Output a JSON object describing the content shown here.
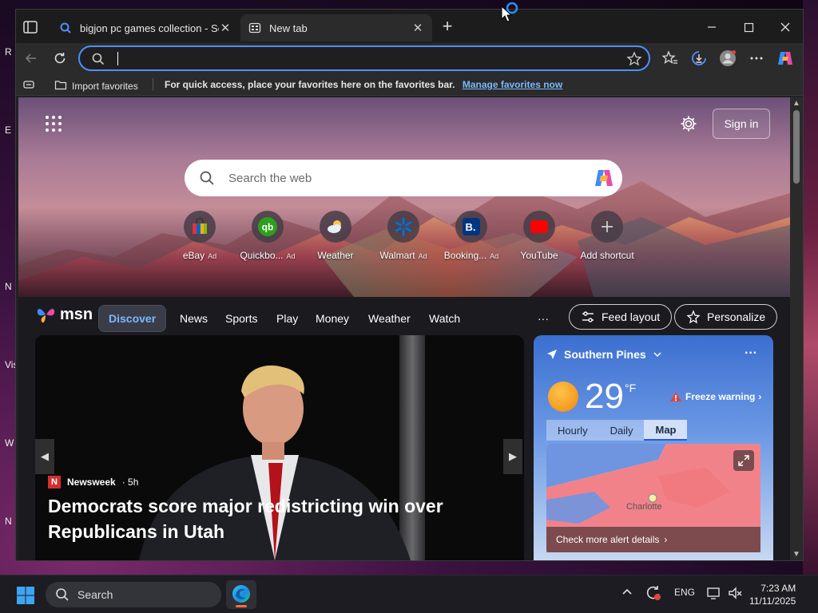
{
  "desktop": {
    "left_fragments": [
      "R",
      "E",
      "N",
      "Vis",
      "W",
      "N"
    ]
  },
  "tabs": [
    {
      "title": "bigjon pc games collection - Sear",
      "active": false,
      "favicon": "search-icon"
    },
    {
      "title": "New tab",
      "active": true,
      "favicon": "newtab-icon"
    }
  ],
  "address_bar": {
    "value": "",
    "placeholder": ""
  },
  "favorites_bar": {
    "import_label": "Import favorites",
    "hint": "For quick access, place your favorites here on the favorites bar.",
    "manage_link": "Manage favorites now"
  },
  "newtab": {
    "signin_label": "Sign in",
    "search_placeholder": "Search the web",
    "shortcuts": [
      {
        "label": "eBay",
        "ad": "Ad",
        "icon": "ebay-icon"
      },
      {
        "label": "Quickbo...",
        "ad": "Ad",
        "icon": "quickbooks-icon"
      },
      {
        "label": "Weather",
        "ad": "",
        "icon": "weather-icon"
      },
      {
        "label": "Walmart",
        "ad": "Ad",
        "icon": "walmart-icon"
      },
      {
        "label": "Booking...",
        "ad": "Ad",
        "icon": "booking-icon"
      },
      {
        "label": "YouTube",
        "ad": "",
        "icon": "youtube-icon"
      },
      {
        "label": "Add shortcut",
        "ad": "",
        "icon": "plus-icon"
      }
    ]
  },
  "msn": {
    "logo_text": "msn",
    "nav": [
      "Discover",
      "News",
      "Sports",
      "Play",
      "Money",
      "Weather",
      "Watch"
    ],
    "more": "···",
    "feed_layout_label": "Feed layout",
    "personalize_label": "Personalize"
  },
  "feed": {
    "source": "Newsweek",
    "age": "· 5h",
    "headline": "Democrats score major redistricting win over Republicans in Utah"
  },
  "weather": {
    "location": "Southern Pines",
    "temperature": "29",
    "unit": "°F",
    "warning": "Freeze warning",
    "tabs": [
      "Hourly",
      "Daily",
      "Map"
    ],
    "active_tab": "Map",
    "map_city": "Charlotte",
    "alert_link": "Check more alert details"
  },
  "taskbar": {
    "search_label": "Search",
    "language": "ENG",
    "time": "7:23 AM",
    "date": "11/11/2025"
  },
  "colors": {
    "accent": "#4d90fe",
    "link": "#7ab8ff",
    "edge_underline": "#ff6a3d"
  }
}
